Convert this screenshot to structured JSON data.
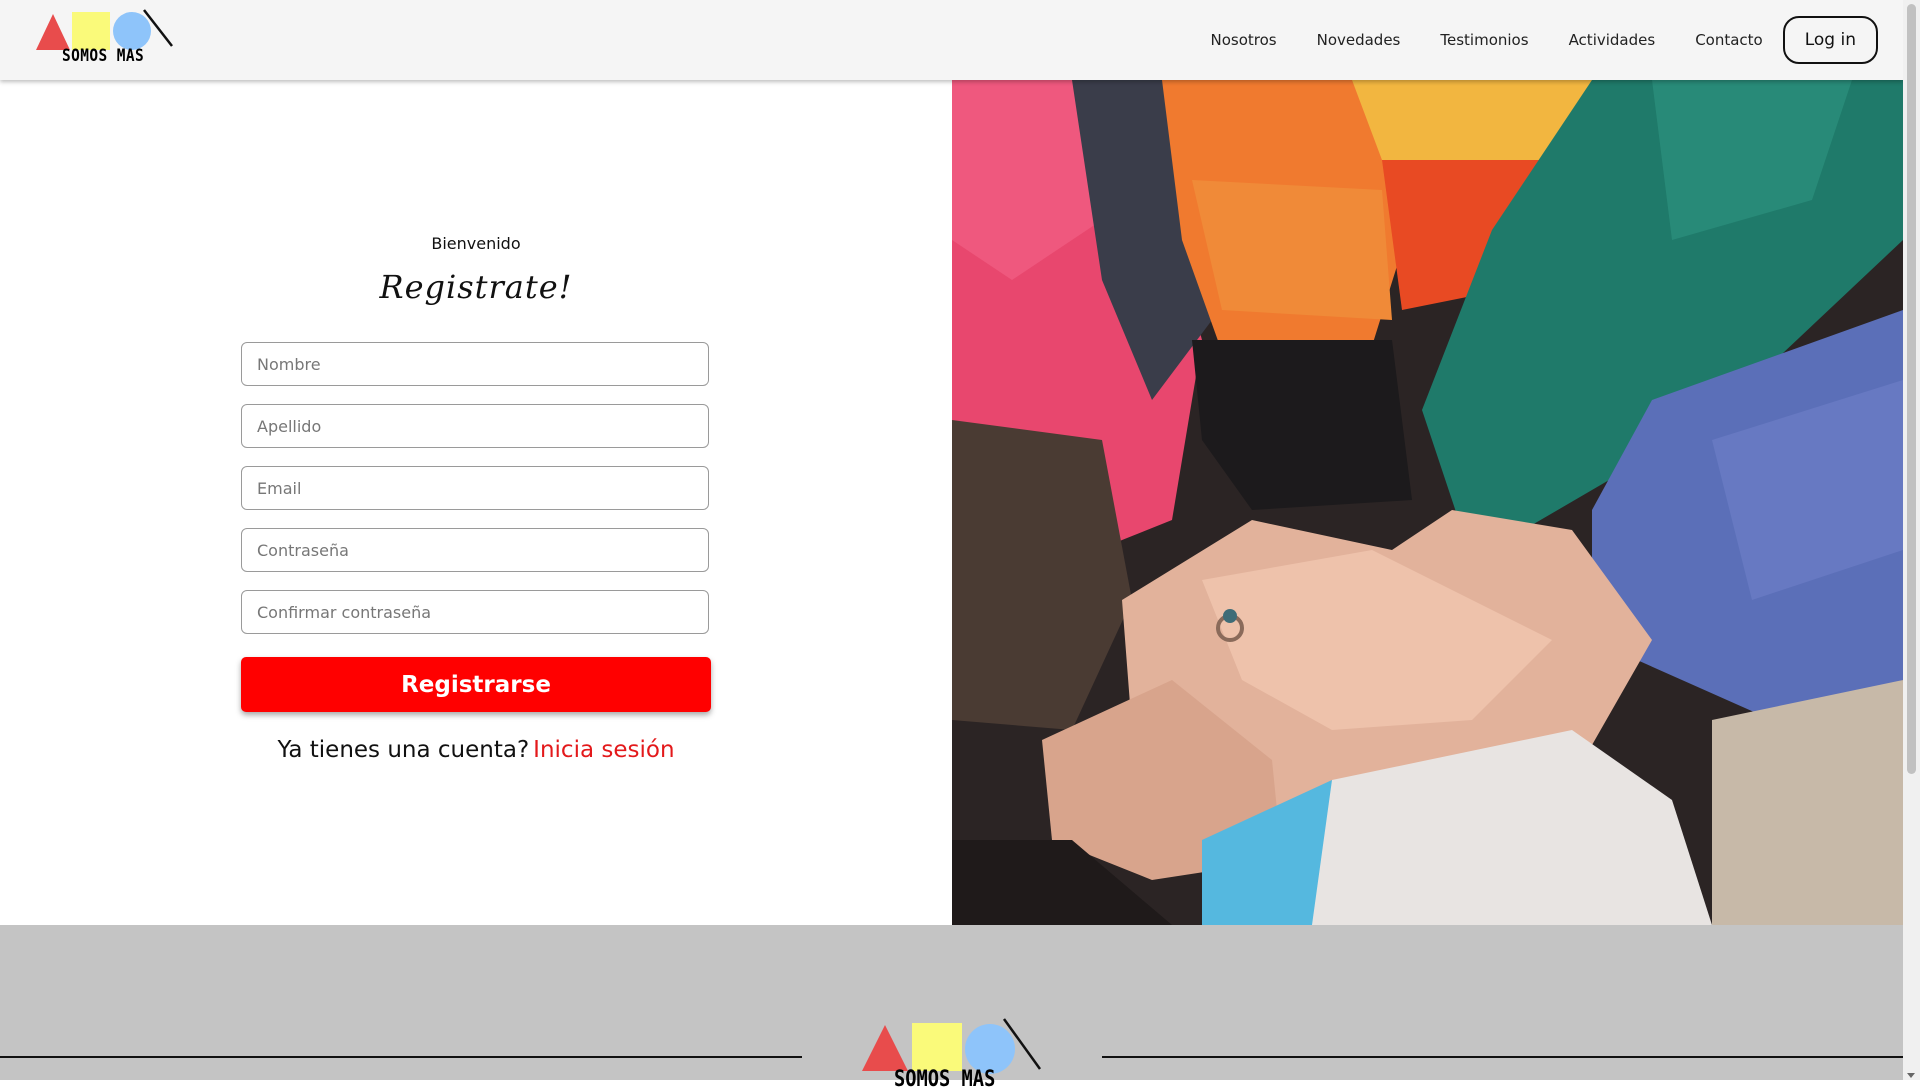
{
  "header": {
    "logo_text": "SOMOS MAS",
    "nav": [
      "Nosotros",
      "Novedades",
      "Testimonios",
      "Actividades",
      "Contacto"
    ],
    "login_label": "Log in"
  },
  "form": {
    "welcome": "Bienvenido",
    "title": "Registrate!",
    "fields": [
      {
        "placeholder": "Nombre"
      },
      {
        "placeholder": "Apellido"
      },
      {
        "placeholder": "Email"
      },
      {
        "placeholder": "Contraseña"
      },
      {
        "placeholder": "Confirmar contraseña"
      }
    ],
    "submit_label": "Registrarse",
    "account_question": "Ya tienes una cuenta?",
    "login_link": "Inicia sesión"
  },
  "footer": {
    "logo_text": "SOMOS MAS"
  },
  "colors": {
    "accent_red": "#ff0000",
    "link_red": "#e3191b",
    "logo_triangle": "#e84c4c",
    "logo_square": "#fafa7a",
    "logo_circle": "#8ec4fa",
    "footer_bg": "#c4c4c4"
  },
  "icons": {
    "logo": "somos-mas-logo",
    "photo": "stacked-hands-photo"
  }
}
